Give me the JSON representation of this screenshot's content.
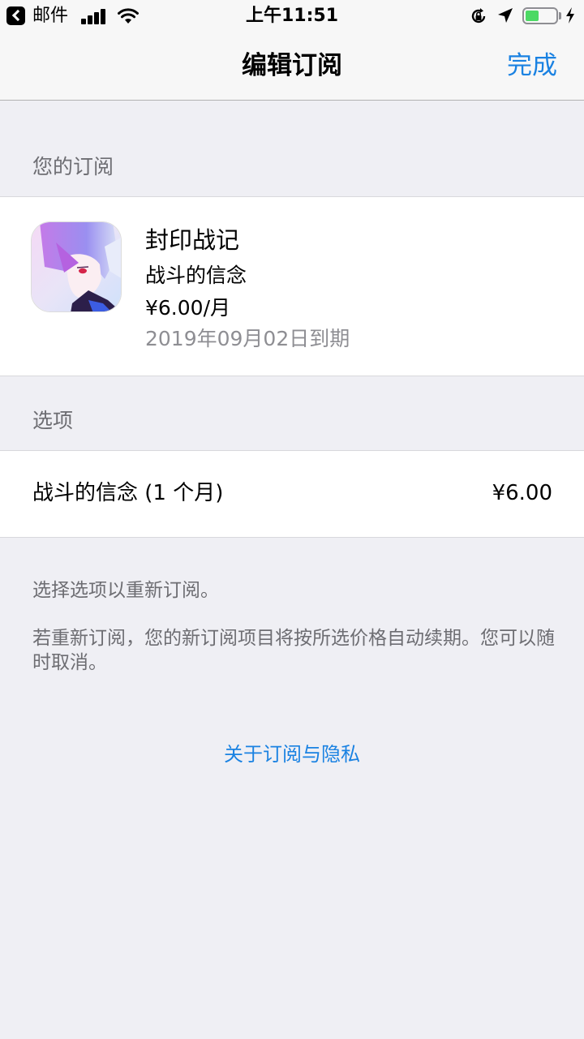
{
  "status_bar": {
    "back_label": "邮件",
    "time": "上午11:51",
    "battery_level": 0.45,
    "icons": [
      "back-arrow-icon",
      "signal-icon",
      "wifi-icon",
      "orientation-lock-icon",
      "location-icon",
      "battery-icon",
      "charging-bolt-icon"
    ]
  },
  "nav": {
    "title": "编辑订阅",
    "done_label": "完成"
  },
  "subscription_section": {
    "header": "您的订阅",
    "app_name": "封印战记",
    "subscription_name": "战斗的信念",
    "price": "¥6.00/月",
    "expiry": "2019年09月02日到期"
  },
  "options_section": {
    "header": "选项",
    "options": [
      {
        "label": "战斗的信念 (1 个月)",
        "price": "¥6.00"
      }
    ]
  },
  "footer": {
    "note1": "选择选项以重新订阅。",
    "note2": "若重新订阅，您的新订阅项目将按所选价格自动续期。您可以随时取消。",
    "privacy_link": "关于订阅与隐私"
  },
  "colors": {
    "accent": "#1a82e2",
    "background": "#efeff4",
    "secondary_text": "#6d6d72",
    "battery": "#4cd964"
  }
}
